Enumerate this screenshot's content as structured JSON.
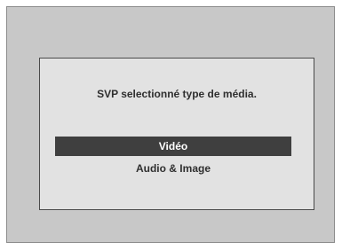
{
  "dialog": {
    "prompt": "SVP selectionné type de média.",
    "options": [
      {
        "label": "Vidéo",
        "selected": true
      },
      {
        "label": "Audio & Image",
        "selected": false
      }
    ]
  },
  "colors": {
    "screen_background": "#c8c8c8",
    "dialog_background": "#e2e2e2",
    "highlight_background": "#3f3f3f",
    "highlight_text": "#ffffff",
    "text": "#2f2f2f"
  }
}
